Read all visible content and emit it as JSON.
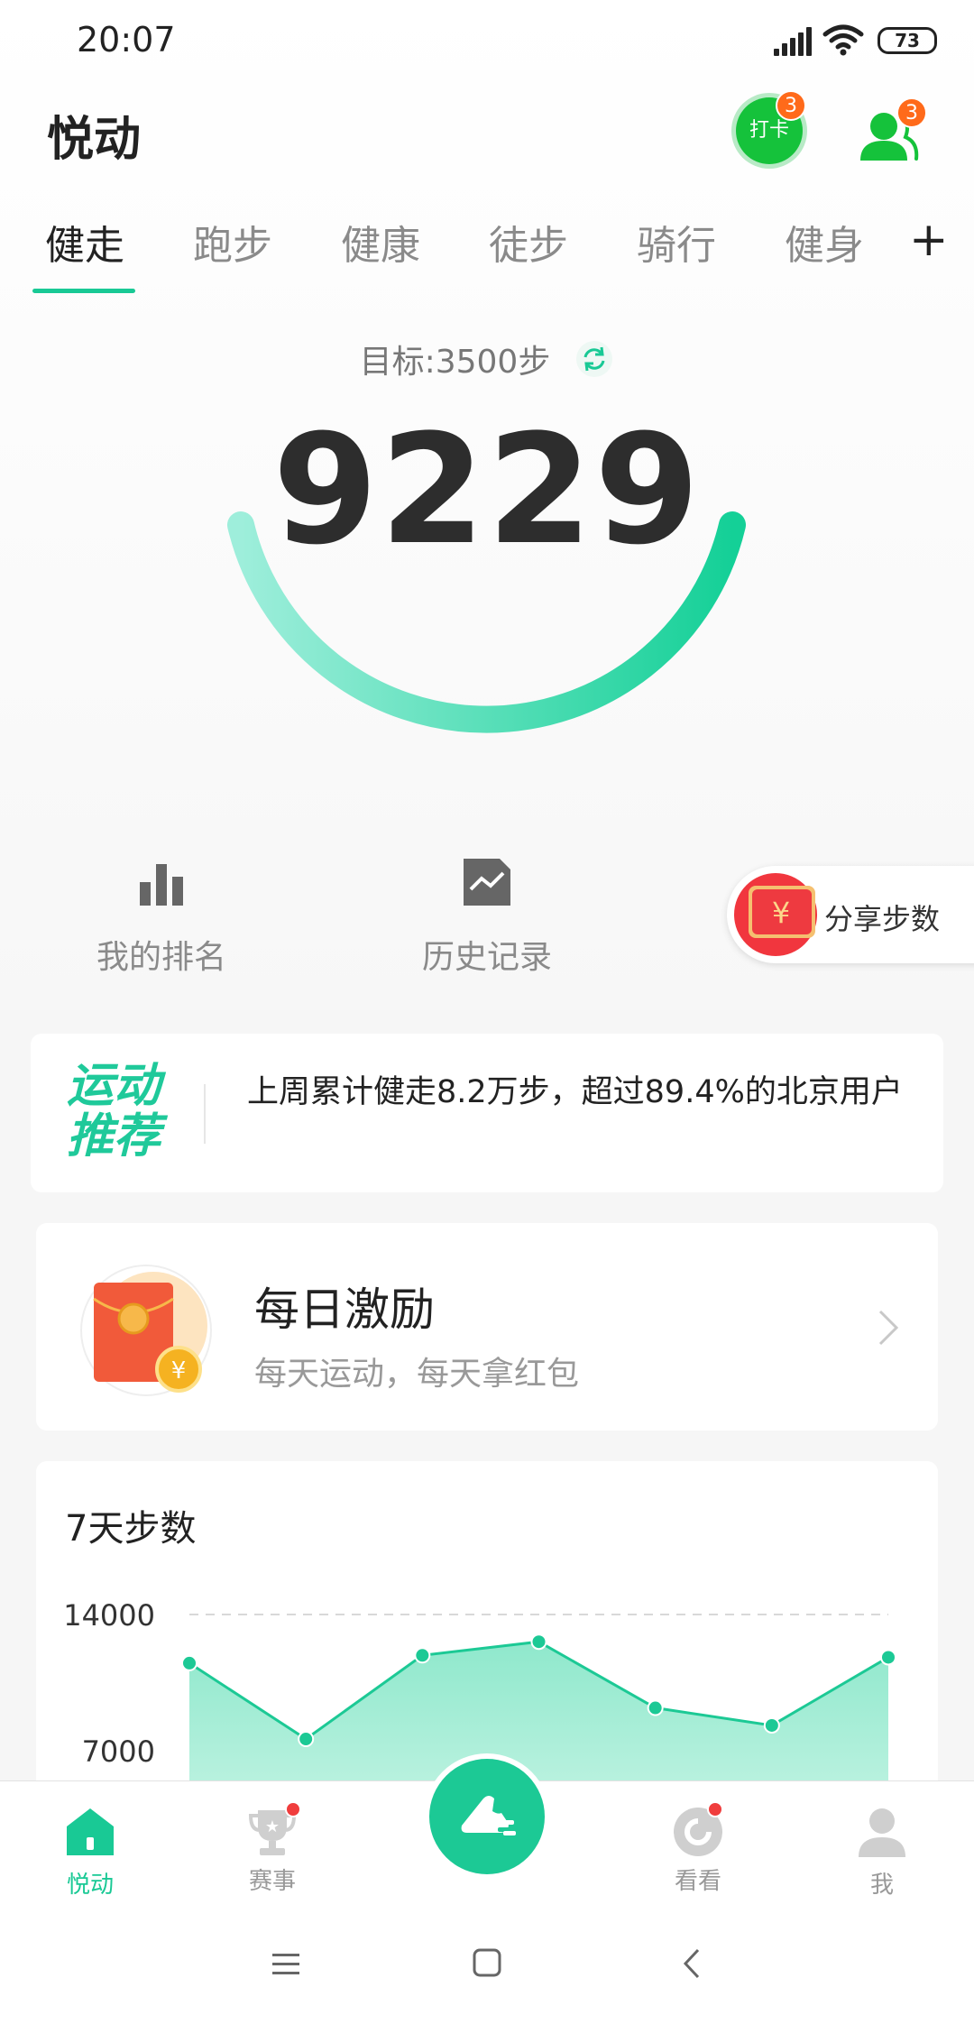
{
  "status_bar": {
    "time": "20:07",
    "battery": "73"
  },
  "header": {
    "title": "悦动",
    "checkin_label": "打卡",
    "checkin_badge": "3",
    "friends_badge": "3"
  },
  "tabs": [
    {
      "label": "健走",
      "active": true
    },
    {
      "label": "跑步"
    },
    {
      "label": "健康"
    },
    {
      "label": "徒步"
    },
    {
      "label": "骑行"
    },
    {
      "label": "健身"
    }
  ],
  "tab_add": "+",
  "steps": {
    "goal_text": "目标:3500步",
    "count": "9229"
  },
  "quick_actions": {
    "ranking": "我的排名",
    "history": "历史记录",
    "share": "分享步数"
  },
  "recommend": {
    "title_line1": "运动",
    "title_line2": "推荐",
    "text": "上周累计健走8.2万步，超过89.4%的北京用户"
  },
  "daily_reward": {
    "title": "每日激励",
    "subtitle": "每天运动，每天拿红包"
  },
  "colors": {
    "accent": "#19c995",
    "checkin_green": "#15c23b",
    "badge_orange": "#ff6a1a",
    "red_dot": "#f03d3d"
  },
  "chart_data": {
    "type": "area",
    "title": "7天步数",
    "y_ticks": [
      "14000",
      "7000"
    ],
    "values": [
      11500,
      7600,
      11900,
      12600,
      9200,
      8300,
      11800
    ],
    "ylim": [
      0,
      14000
    ],
    "grid": "dashed"
  },
  "bottom_nav": {
    "home": "悦动",
    "events": "赛事",
    "watch": "看看",
    "me": "我"
  }
}
